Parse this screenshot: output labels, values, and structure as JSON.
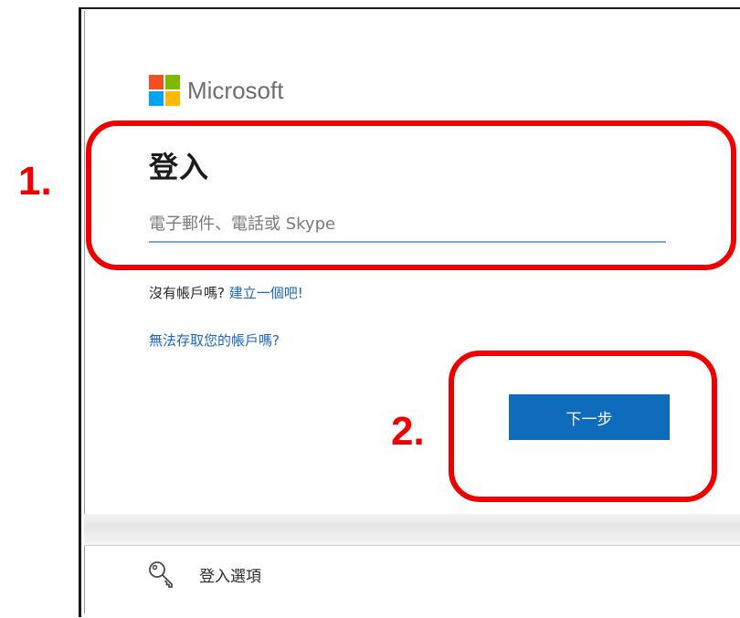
{
  "brand": {
    "name": "Microsoft",
    "logo_colors": [
      "#f25022",
      "#7fba00",
      "#00a4ef",
      "#ffb900"
    ]
  },
  "signin": {
    "title": "登入",
    "email_placeholder": "電子郵件、電話或 Skype",
    "email_value": "",
    "no_account_text": "沒有帳戶嗎?",
    "create_link": "建立一個吧!",
    "cant_access_link": "無法存取您的帳戶嗎?",
    "next_label": "下一步"
  },
  "footer": {
    "options_icon": "key-icon",
    "options_label": "登入選項"
  },
  "annotations": {
    "step1": "1.",
    "step2": "2.",
    "color": "#ee0000"
  }
}
